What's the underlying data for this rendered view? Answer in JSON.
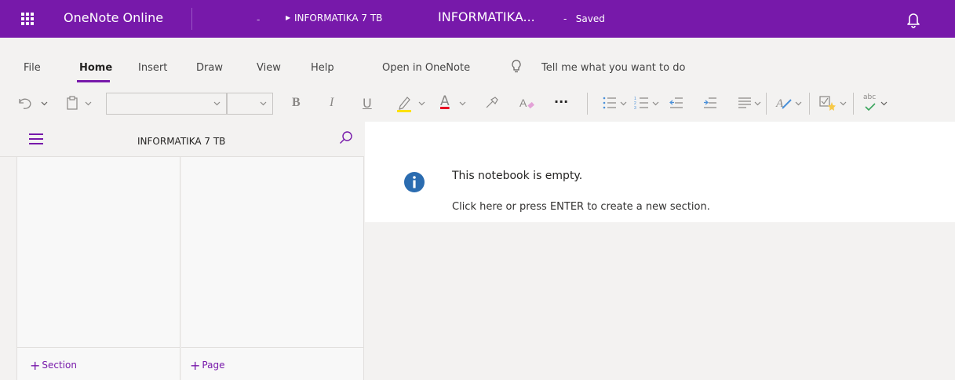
{
  "app": {
    "name": "OneNote Online",
    "breadcrumb_separator": "-",
    "notebook": "INFORMATIKA 7 TB",
    "title": "INFORMATIKA...",
    "status_separator": "-",
    "status": "Saved",
    "brand_color": "#7719aa"
  },
  "ribbon": {
    "tabs": [
      "File",
      "Home",
      "Insert",
      "Draw",
      "View",
      "Help",
      "Open in OneNote"
    ],
    "active_tab": "Home",
    "tell_me": "Tell me what you want to do",
    "toolbar": {
      "bold": "B",
      "italic": "I",
      "underline": "U",
      "font_color_letter": "A",
      "more": "···",
      "spell_label": "abc",
      "font_name_value": "",
      "font_size_value": ""
    }
  },
  "navigation": {
    "notebook_name": "INFORMATIKA 7 TB",
    "add_section": "Section",
    "add_page": "Page",
    "plus_glyph": "+"
  },
  "canvas": {
    "empty_title": "This notebook is empty.",
    "empty_hint": "Click here or press ENTER to create a new section.",
    "info_color": "#2b6cb0"
  }
}
